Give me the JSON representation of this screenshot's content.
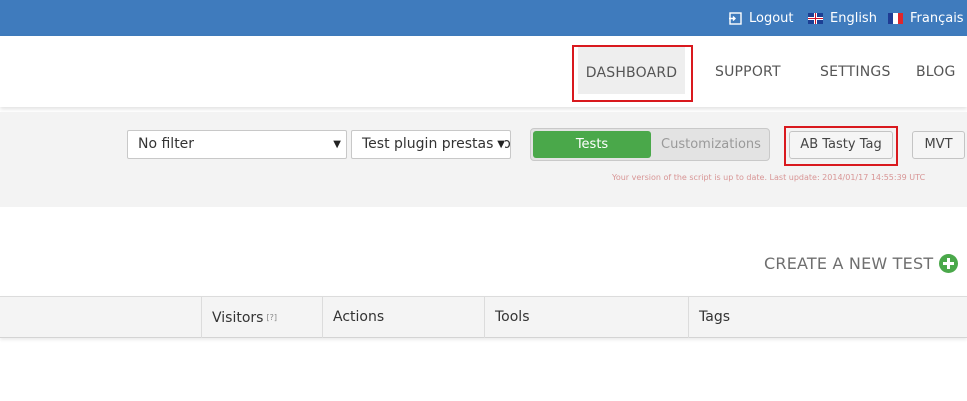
{
  "topbar": {
    "logout": "Logout",
    "english": "English",
    "francais": "Français"
  },
  "nav": {
    "items": [
      "DASHBOARD",
      "SUPPORT",
      "SETTINGS",
      "BLOG"
    ]
  },
  "filters": {
    "filter_select": "No filter",
    "project_select": "Test plugin prestashop"
  },
  "toggle": {
    "tests": "Tests",
    "customizations": "Customizations"
  },
  "buttons": {
    "ab_tasty_tag": "AB Tasty Tag",
    "mvt": "MVT"
  },
  "status_text": "Your version of the script is up to date. Last update: 2014/01/17 14:55:39 UTC",
  "create_new_test": "CREATE A NEW TEST",
  "table": {
    "headers": [
      "Visitors",
      "Actions",
      "Tools",
      "Tags"
    ],
    "visitors_help": "[?]"
  },
  "colors": {
    "topbar": "#3f7bbd",
    "accent_green": "#4aa84a",
    "highlight_red": "#d9191e"
  },
  "icons": [
    "logout-icon",
    "uk-flag-icon",
    "france-flag-icon",
    "chevron-down-icon",
    "plus-circle-icon"
  ]
}
